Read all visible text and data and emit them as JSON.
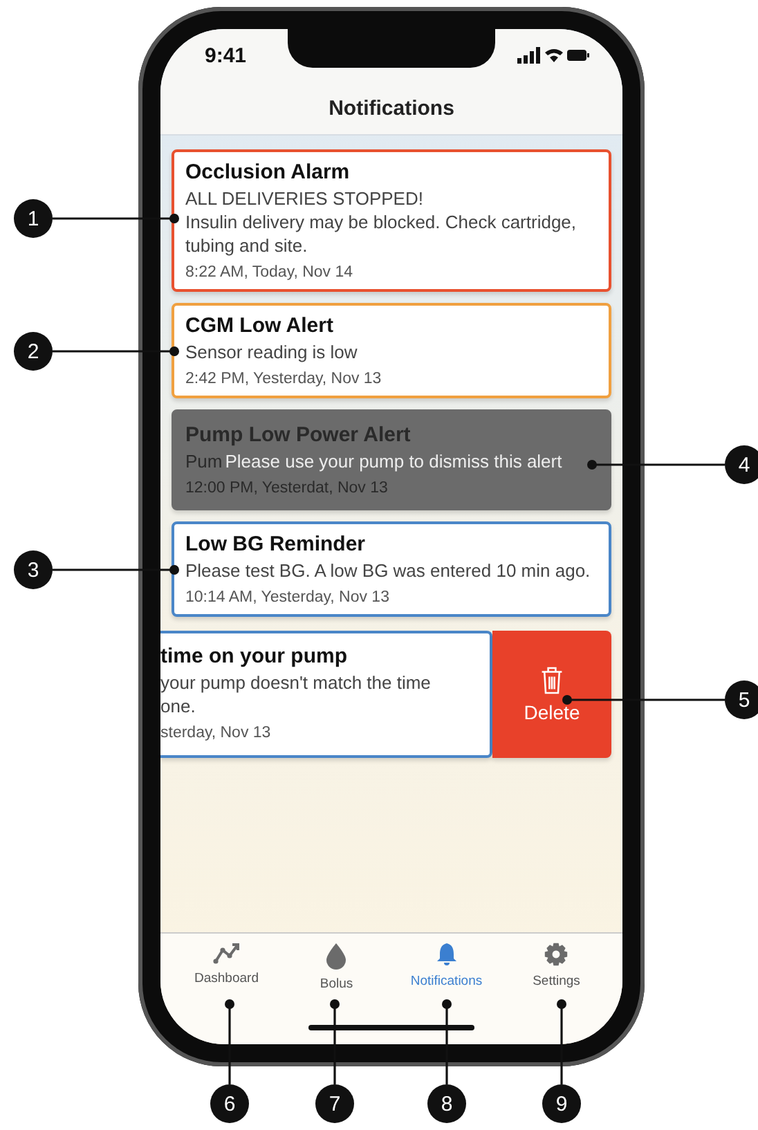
{
  "status_bar": {
    "time": "9:41"
  },
  "header": {
    "title": "Notifications"
  },
  "notifications": [
    {
      "kind": "alert",
      "color": "#e8512f",
      "title": "Occlusion Alarm",
      "lines": [
        "ALL DELIVERIES STOPPED!",
        "Insulin delivery may be blocked. Check cartridge, tubing and site."
      ],
      "time": "8:22 AM, Today, Nov 14"
    },
    {
      "kind": "alert",
      "color": "#f0a040",
      "title": "CGM Low Alert",
      "lines": [
        "Sensor reading is low"
      ],
      "time": "2:42 PM, Yesterday, Nov 13"
    },
    {
      "kind": "locked",
      "title": "Pump Low Power Alert",
      "lines": [
        "Pum"
      ],
      "time": "12:00 PM, Yesterdat, Nov 13",
      "message": "Please use your pump to dismiss this alert"
    },
    {
      "kind": "alert",
      "color": "#4a86c8",
      "title": "Low BG Reminder",
      "lines": [
        "Please test BG. A low BG was entered 10 min ago."
      ],
      "time": "10:14 AM, Yesterday, Nov 13"
    },
    {
      "kind": "swiped",
      "color": "#4a86c8",
      "title": "time on your pump",
      "lines": [
        "your pump doesn't match the time",
        "one."
      ],
      "time": "sterday, Nov 13",
      "action": "Delete"
    }
  ],
  "tabs": [
    {
      "label": "Dashboard",
      "selected": false
    },
    {
      "label": "Bolus",
      "selected": false
    },
    {
      "label": "Notifications",
      "selected": true
    },
    {
      "label": "Settings",
      "selected": false
    }
  ],
  "callouts": [
    "1",
    "2",
    "3",
    "4",
    "5",
    "6",
    "7",
    "8",
    "9"
  ]
}
